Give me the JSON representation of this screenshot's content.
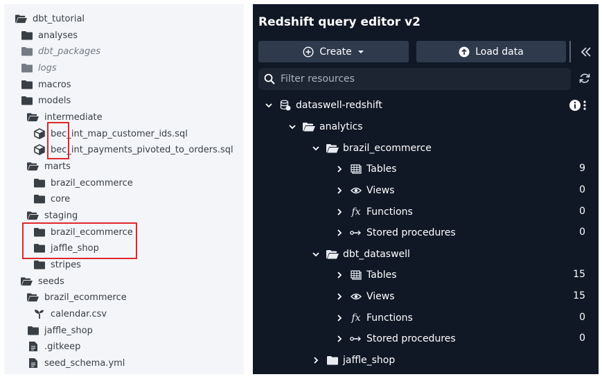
{
  "file_tree": {
    "root": "dbt_tutorial",
    "items": [
      {
        "label": "analyses"
      },
      {
        "label": "dbt_packages"
      },
      {
        "label": "logs"
      },
      {
        "label": "macros"
      },
      {
        "label": "models"
      },
      {
        "label": "intermediate"
      },
      {
        "label": "bec_int_map_customer_ids.sql"
      },
      {
        "label": "bec_int_payments_pivoted_to_orders.sql"
      },
      {
        "label": "marts"
      },
      {
        "label": "brazil_ecommerce"
      },
      {
        "label": "core"
      },
      {
        "label": "staging"
      },
      {
        "label": "brazil_ecommerce"
      },
      {
        "label": "jaffle_shop"
      },
      {
        "label": "stripes"
      },
      {
        "label": "seeds"
      },
      {
        "label": "brazil_ecommerce"
      },
      {
        "label": "calendar.csv"
      },
      {
        "label": "jaffle_shop"
      },
      {
        "label": ".gitkeep"
      },
      {
        "label": "seed_schema.yml"
      }
    ]
  },
  "editor": {
    "title": "Redshift query editor v2",
    "create_label": "Create",
    "load_label": "Load data",
    "filter_placeholder": "Filter resources",
    "connection": "dataswell-redshift",
    "database": "analytics",
    "schemas": [
      {
        "name": "brazil_ecommerce",
        "groups": [
          {
            "label": "Tables",
            "count": "9"
          },
          {
            "label": "Views",
            "count": "0"
          },
          {
            "label": "Functions",
            "count": "0"
          },
          {
            "label": "Stored procedures",
            "count": "0"
          }
        ]
      },
      {
        "name": "dbt_dataswell",
        "groups": [
          {
            "label": "Tables",
            "count": "15"
          },
          {
            "label": "Views",
            "count": "15"
          },
          {
            "label": "Functions",
            "count": "0"
          },
          {
            "label": "Stored procedures",
            "count": "0"
          }
        ]
      },
      {
        "name": "jaffle_shop"
      }
    ]
  },
  "colors": {
    "left_background": "#f3f5f8",
    "right_background": "#101826",
    "button": "#2f3b4d",
    "highlight_box": "#e0262c"
  },
  "icons": {
    "folder_closed": "folder-icon",
    "folder_open": "folder-open-icon",
    "sql_model": "cube-icon",
    "seed": "sprout-icon",
    "file": "file-icon",
    "tables": "table-icon",
    "views": "eye-icon",
    "functions": "fx-icon",
    "procedures": "procedure-icon"
  }
}
